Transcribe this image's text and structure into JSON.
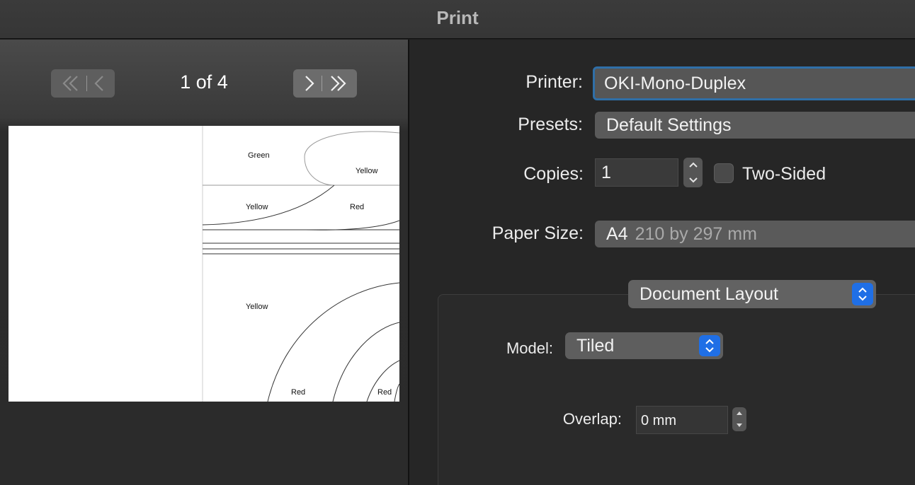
{
  "window": {
    "title": "Print"
  },
  "preview": {
    "page_indicator": "1 of 4",
    "labels": {
      "green": "Green",
      "yellow_top": "Yellow",
      "yellow_mid": "Yellow",
      "red_mid": "Red",
      "yellow_low": "Yellow",
      "red_bottom_1": "Red",
      "red_bottom_2": "Red"
    }
  },
  "settings": {
    "printer_label": "Printer:",
    "printer_value": "OKI-Mono-Duplex",
    "presets_label": "Presets:",
    "presets_value": "Default Settings",
    "copies_label": "Copies:",
    "copies_value": "1",
    "two_sided_label": "Two-Sided",
    "two_sided_checked": false,
    "paper_size_label": "Paper Size:",
    "paper_size_value": "A4",
    "paper_size_detail": "210 by 297 mm",
    "section_popup": "Document Layout",
    "model_label": "Model:",
    "model_value": "Tiled",
    "overlap_label": "Overlap:",
    "overlap_value": "0 mm"
  },
  "colors": {
    "accent": "#1f6fe6",
    "focus_ring": "#2f6fa8"
  }
}
